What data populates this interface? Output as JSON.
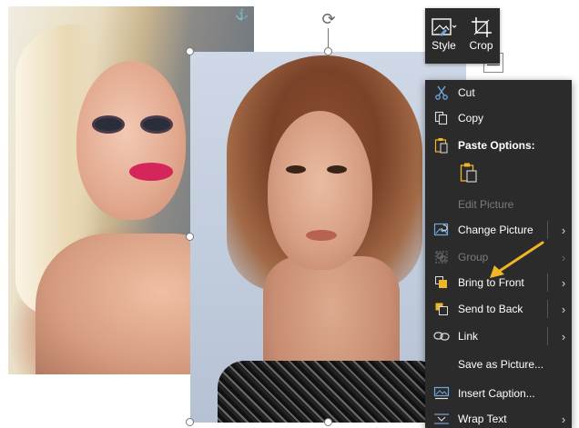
{
  "mini_toolbar": {
    "style_label": "Style",
    "crop_label": "Crop"
  },
  "context_menu": {
    "items": [
      {
        "label": "Cut",
        "icon": "scissors-icon",
        "enabled": true
      },
      {
        "label": "Copy",
        "icon": "copy-icon",
        "enabled": true
      },
      {
        "label": "Paste Options:",
        "icon": "paste-icon",
        "enabled": true,
        "bold": true
      },
      {
        "label": "Edit Picture",
        "icon": "",
        "enabled": false
      },
      {
        "label": "Change Picture",
        "icon": "change-picture-icon",
        "enabled": true,
        "submenu": true
      },
      {
        "label": "Group",
        "icon": "group-icon",
        "enabled": false,
        "submenu": true
      },
      {
        "label": "Bring to Front",
        "icon": "bring-to-front-icon",
        "enabled": true,
        "submenu": true
      },
      {
        "label": "Send to Back",
        "icon": "send-to-back-icon",
        "enabled": true,
        "submenu": true
      },
      {
        "label": "Link",
        "icon": "link-icon",
        "enabled": true,
        "submenu": true
      },
      {
        "label": "Save as Picture...",
        "icon": "",
        "enabled": true
      },
      {
        "label": "Insert Caption...",
        "icon": "insert-caption-icon",
        "enabled": true
      },
      {
        "label": "Wrap Text",
        "icon": "wrap-text-icon",
        "enabled": true,
        "submenu": true
      }
    ]
  },
  "colors": {
    "menu_bg": "#2b2b2b",
    "accent_orange": "#f0b429",
    "icon_blue": "#6fa8dc"
  }
}
